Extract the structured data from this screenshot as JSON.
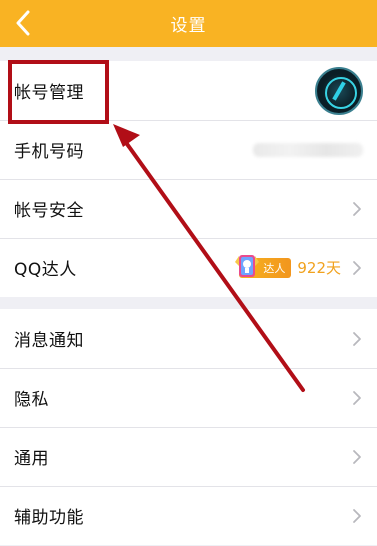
{
  "header": {
    "title": "设置",
    "bg_color": "#f9b323"
  },
  "group1": [
    {
      "label": "帐号管理",
      "right": "avatar"
    },
    {
      "label": "手机号码",
      "right": "phone-blurred"
    },
    {
      "label": "帐号安全",
      "right": "chevron"
    },
    {
      "label": "QQ达人",
      "right": "daren",
      "badge_text": "达人",
      "days": "922天"
    }
  ],
  "group2": [
    {
      "label": "消息通知"
    },
    {
      "label": "隐私"
    },
    {
      "label": "通用"
    },
    {
      "label": "辅助功能"
    }
  ],
  "annotation": {
    "color": "#b10e17"
  }
}
